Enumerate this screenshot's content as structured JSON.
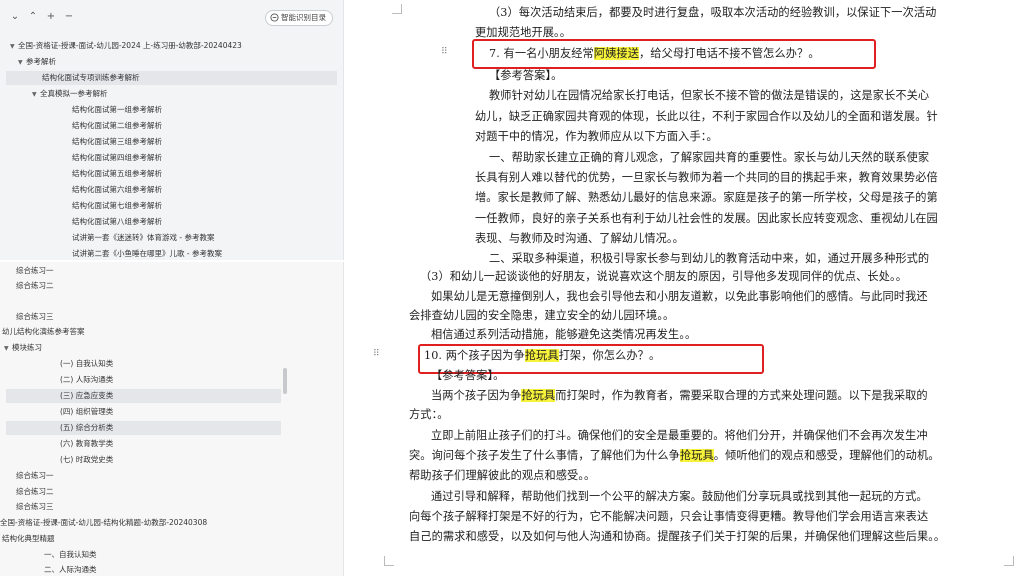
{
  "toolbar": {
    "collapse_label": "⌄",
    "up_label": "⌃",
    "add_label": "+",
    "remove_label": "−",
    "smart_button_label": "智能识别目录"
  },
  "nav_top": {
    "items": [
      {
        "label": "全国-资格证-授课-面试-幼儿园-2024 上-练习册-幼教部-20240423"
      },
      {
        "label": "参考解析"
      },
      {
        "label": "结构化面试专项训练参考解析"
      },
      {
        "label": "全真模拟一参考解析"
      },
      {
        "label": "结构化面试第一组参考解析"
      },
      {
        "label": "结构化面试第二组参考解析"
      },
      {
        "label": "结构化面试第三组参考解析"
      },
      {
        "label": "结构化面试第四组参考解析"
      },
      {
        "label": "结构化面试第五组参考解析"
      },
      {
        "label": "结构化面试第六组参考解析"
      },
      {
        "label": "结构化面试第七组参考解析"
      },
      {
        "label": "结构化面试第八组参考解析"
      },
      {
        "label": "试讲第一套《迷迷转》体育游戏 - 参考教案"
      },
      {
        "label": "试讲第二套《小鱼睡在哪里》儿歌 - 参考教案"
      }
    ]
  },
  "nav_bottom": {
    "items": [
      {
        "label": "综合练习一"
      },
      {
        "label": "综合练习二"
      },
      {
        "label": "综合练习三"
      },
      {
        "label": "幼儿结构化演练参考答案"
      },
      {
        "label": "模块练习"
      },
      {
        "label": "(一) 自我认知类"
      },
      {
        "label": "(二) 人际沟通类"
      },
      {
        "label": "(三) 应急应变类"
      },
      {
        "label": "(四) 组织管理类"
      },
      {
        "label": "(五) 综合分析类"
      },
      {
        "label": "(六) 教育教学类"
      },
      {
        "label": "(七) 时政党史类"
      },
      {
        "label": "综合练习一"
      },
      {
        "label": "综合练习二"
      },
      {
        "label": "综合练习三"
      },
      {
        "label": "全国-资格证-授课-面试-幼儿园-结构化精题-幼教部-20240308"
      },
      {
        "label": "结构化典型精题"
      },
      {
        "label": "一、自我认知类"
      },
      {
        "label": "二、人际沟通类"
      }
    ]
  },
  "doc_top": {
    "lines": [
      "（3）每次活动结束后，都要及时进行复盘，吸取本次活动的经验教训，以保证下一次活动",
      "更加规范地开展。。",
      "【参考答案】。",
      "教师针对幼儿在园情况给家长打电话，但家长不接不管的做法是错误的，这是家长不关心",
      "幼儿，缺乏正确家园共育观的体现，长此以往，不利于家园合作以及幼儿的全面和谐发展。针",
      "对题干中的情况，作为教师应从以下方面入手：。",
      "一、帮助家长建立正确的育儿观念，了解家园共育的重要性。家长与幼儿天然的联系使家",
      "长具有别人难以替代的优势，一旦家长与教师为着一个共同的目的携起手来，教育效果势必倍",
      "增。家长是教师了解、熟悉幼儿最好的信息来源。家庭是孩子的第一所学校，父母是孩子的第",
      "一任教师，良好的亲子关系也有利于幼儿社会性的发展。因此家长应转变观念、重视幼儿在园",
      "表现、与教师及时沟通、了解幼儿情况。。",
      "二、采取多种渠道，积极引导家长参与到幼儿的教育活动中来，如，通过开展多种形式的"
    ],
    "question": {
      "prefix": "7. 有一名小朋友经常",
      "highlight": "阿姨接送",
      "suffix": "，给父母打电话不接不管怎么办？。"
    }
  },
  "doc_bottom": {
    "lines": [
      "（3）和幼儿一起谈谈他的好朋友，说说喜欢这个朋友的原因，引导他多发现同伴的优点、长处。。",
      "如果幼儿是无意撞倒别人，我也会引导他去和小朋友道歉，以免此事影响他们的感情。与此同时我还",
      "会排查幼儿园的安全隐患，建立安全的幼儿园环境。。",
      "相信通过系列活动措施，能够避免这类情况再发生。。",
      "【参考答案】。",
      "方式：。",
      "立即上前阻止孩子们的打斗。确保他们的安全是最重要的。将他们分开，并确保他们不会再次发生冲",
      "帮助孩子们理解彼此的观点和感受。。",
      "通过引导和解释，帮助他们找到一个公平的解决方案。鼓励他们分享玩具或找到其他一起玩的方式。",
      "向每个孩子解释打架是不好的行为，它不能解决问题，只会让事情变得更糟。教导他们学会用语言来表达",
      "自己的需求和感受，以及如何与他人沟通和协商。提醒孩子们关于打架的后果，并确保他们理解这些后果。。"
    ],
    "question": {
      "prefix": "10. 两个孩子因为争",
      "highlight": "抢玩具",
      "suffix": "打架，你怎么办？。"
    },
    "answer_line": {
      "prefix": "当两个孩子因为争",
      "highlight": "抢玩具",
      "suffix": "而打架时，作为教育者，需要采取合理的方式来处理问题。以下是我采取的"
    },
    "ask_line": {
      "prefix": "突。询问每个孩子发生了什么事情，了解他们为什么争",
      "highlight": "抢玩具",
      "suffix": "。倾听他们的观点和感受，理解他们的动机。"
    }
  },
  "colors": {
    "highlight": "#f7f23a",
    "box": "#e02020",
    "nav_bg": "#f3f4f6"
  }
}
